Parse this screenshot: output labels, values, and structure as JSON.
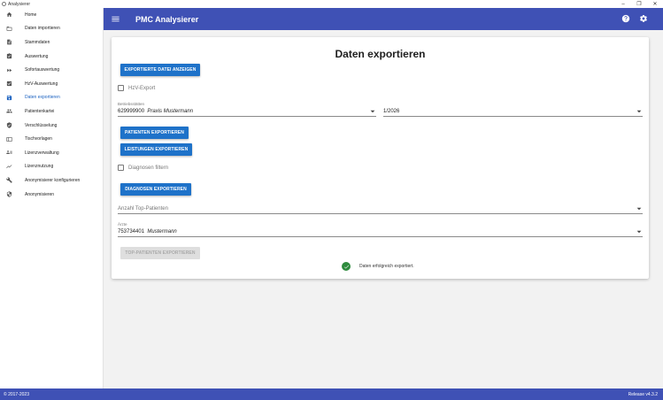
{
  "window": {
    "title": "Analysierer"
  },
  "sidebar": {
    "items": [
      {
        "label": "Home",
        "icon": "home-icon",
        "active": false
      },
      {
        "label": "Daten importieren",
        "icon": "folder-icon",
        "active": false
      },
      {
        "label": "Stammdaten",
        "icon": "document-icon",
        "active": false
      },
      {
        "label": "Auswertung",
        "icon": "clipboard-check-icon",
        "active": false
      },
      {
        "label": "Sofortauswertung",
        "icon": "fast-forward-icon",
        "active": false
      },
      {
        "label": "HzV-Auswertung",
        "icon": "checkbox-icon",
        "active": false
      },
      {
        "label": "Daten exportieren",
        "icon": "save-icon",
        "active": true
      },
      {
        "label": "Patientenkartei",
        "icon": "people-icon",
        "active": false
      },
      {
        "label": "Verschlüsselung",
        "icon": "shield-icon",
        "active": false
      },
      {
        "label": "Tischvorlagen",
        "icon": "table-icon",
        "active": false
      },
      {
        "label": "Lizenzverwaltung",
        "icon": "license-icon",
        "active": false
      },
      {
        "label": "Lizenznutzung",
        "icon": "trending-icon",
        "active": false
      },
      {
        "label": "Anonymisierer konfigurieren",
        "icon": "wrench-icon",
        "active": false
      },
      {
        "label": "Anonymisieren",
        "icon": "shield-lock-icon",
        "active": false
      }
    ]
  },
  "appbar": {
    "title": "PMC Analysierer"
  },
  "main": {
    "title": "Daten exportieren",
    "show_exported_button": "EXPORTIERTE DATEI ANZEIGEN",
    "hzv_export_label": "HzV-Export",
    "practice_field_label": "Betriebsstätten",
    "practice_number": "629999900",
    "practice_name": "Praxis Mustermann",
    "quarter_value": "1/2026",
    "export_patients_button": "PATIENTEN EXPORTIEREN",
    "export_services_button": "LEISTUNGEN EXPORTIEREN",
    "filter_diagnoses_label": "Diagnosen filtern",
    "export_diagnoses_button": "DIAGNOSEN EXPORTIEREN",
    "top_patients_placeholder": "Anzahl Top-Patienten",
    "doctor_field_label": "Ärzte",
    "doctor_number": "753734401",
    "doctor_name": "Mustermann",
    "export_top_patients_button": "TOP-PATIENTEN EXPORTIEREN",
    "status_message": "Daten erfolgreich exportiert."
  },
  "footer": {
    "copyright": "© 2017-2023",
    "release": "Release v4.3.2"
  },
  "colors": {
    "primary": "#3f51b5",
    "button": "#1e72c9",
    "active_nav": "#1a61c0",
    "success": "#2e8b3e"
  }
}
